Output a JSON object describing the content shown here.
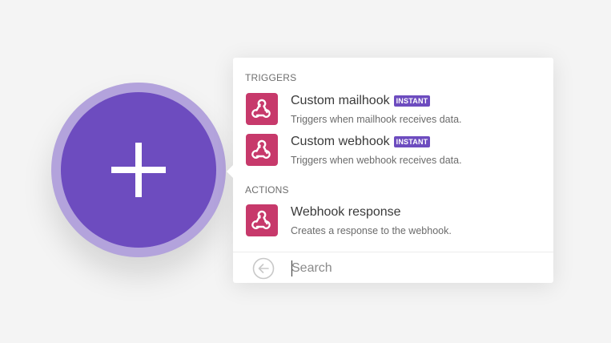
{
  "module": {
    "icon": "plus-icon",
    "ring_color": "#b3a3dc",
    "core_color": "#6d4cbf"
  },
  "menu": {
    "sections": [
      {
        "header": "TRIGGERS",
        "items": [
          {
            "title": "Custom mailhook",
            "badge": "INSTANT",
            "description": "Triggers when mailhook receives data.",
            "icon": "webhook-icon"
          },
          {
            "title": "Custom webhook",
            "badge": "INSTANT",
            "description": "Triggers when webhook receives data.",
            "icon": "webhook-icon"
          }
        ]
      },
      {
        "header": "ACTIONS",
        "items": [
          {
            "title": "Webhook response",
            "description": "Creates a response to the webhook.",
            "icon": "webhook-icon"
          }
        ]
      }
    ],
    "icon_color": "#c7396b",
    "badge_color": "#6d4cbf"
  },
  "search": {
    "placeholder": "Search",
    "value": "",
    "back_icon": "arrow-left-circle-icon"
  }
}
